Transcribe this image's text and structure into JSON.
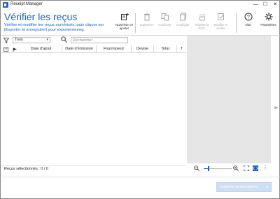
{
  "window": {
    "title": "Receipt Manager",
    "minimize": "—",
    "maximize": "☐",
    "close": "✕"
  },
  "header": {
    "title": "Vérifier les reçus",
    "description": "Vérifier et modifier les reçus numérisés, puis cliquer sur [Exporter et enregistrer] pour exporter/enreg."
  },
  "toolbar": {
    "scan_add": "Numériser et ajouter",
    "delete": "Supprimer",
    "combine": "Combiner",
    "duplicate": "Dupliquer",
    "ocr_badge": "OCR",
    "redo_ocr": "Répéter la ROC",
    "edit_verify": "Modifier et vérifier",
    "help": "Aide",
    "settings": "Paramètres"
  },
  "filter": {
    "selected": "Tous"
  },
  "search": {
    "placeholder": "Rechercher"
  },
  "table": {
    "columns": [
      "Date d'ajout",
      "Date d'émission",
      "Fournisseur",
      "Devise",
      "Total",
      "T"
    ]
  },
  "status": {
    "selected_text": "Reçus sélectionnés : 0 / 0"
  },
  "zoom": {
    "level": 0.18
  },
  "footer": {
    "export_button": "Exporter et enregistrer"
  },
  "colors": {
    "accent": "#1f5fb6",
    "preview_bg": "#e6e6e6",
    "disabled_button": "#cfdff3"
  }
}
